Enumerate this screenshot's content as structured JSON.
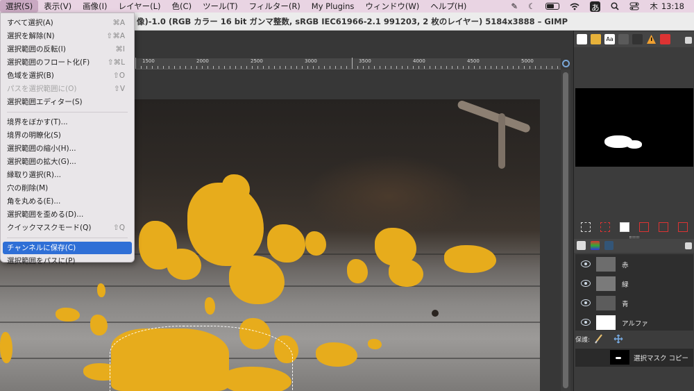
{
  "menubar": {
    "items": [
      "選択(S)",
      "表示(V)",
      "画像(I)",
      "レイヤー(L)",
      "色(C)",
      "ツール(T)",
      "フィルター(R)",
      "My Plugins",
      "ウィンドウ(W)",
      "ヘルプ(H)"
    ],
    "active_index": 0,
    "clock_day": "木",
    "clock_time": "13:18",
    "ime_label": "あ"
  },
  "window": {
    "title": "像)-1.0 (RGB カラー 16 bit ガンマ整数, sRGB IEC61966-2.1 991203, 2 枚のレイヤー) 5184x3888 – GIMP"
  },
  "ruler": {
    "labels": [
      "1500",
      "2000",
      "2500",
      "3000",
      "3500",
      "4000",
      "4500",
      "5000"
    ]
  },
  "select_menu": {
    "items": [
      {
        "label": "すべて選択(A)",
        "shortcut": "⌘A",
        "disabled": false
      },
      {
        "label": "選択を解除(N)",
        "shortcut": "⇧⌘A",
        "disabled": false
      },
      {
        "label": "選択範囲の反転(I)",
        "shortcut": "⌘I",
        "disabled": false
      },
      {
        "label": "選択範囲のフロート化(F)",
        "shortcut": "⇧⌘L",
        "disabled": false
      },
      {
        "label": "色域を選択(B)",
        "shortcut": "⇧O",
        "disabled": false
      },
      {
        "label": "パスを選択範囲に(O)",
        "shortcut": "⇧V",
        "disabled": true
      },
      {
        "label": "選択範囲エディター(S)",
        "shortcut": "",
        "disabled": false
      },
      {
        "label": "境界をぼかす(T)...",
        "shortcut": "",
        "disabled": false
      },
      {
        "label": "境界の明瞭化(S)",
        "shortcut": "",
        "disabled": false
      },
      {
        "label": "選択範囲の縮小(H)...",
        "shortcut": "",
        "disabled": false
      },
      {
        "label": "選択範囲の拡大(G)...",
        "shortcut": "",
        "disabled": false
      },
      {
        "label": "縁取り選択(R)...",
        "shortcut": "",
        "disabled": false
      },
      {
        "label": "穴の削除(M)",
        "shortcut": "",
        "disabled": false
      },
      {
        "label": "角を丸める(E)...",
        "shortcut": "",
        "disabled": false
      },
      {
        "label": "選択範囲を歪める(D)...",
        "shortcut": "",
        "disabled": false
      },
      {
        "label": "クイックマスクモード(Q)",
        "shortcut": "⇧Q",
        "disabled": false
      },
      {
        "label": "チャンネルに保存(C)",
        "shortcut": "",
        "disabled": false,
        "highlighted": true
      },
      {
        "label": "選択範囲をパスに(P)",
        "shortcut": "",
        "disabled": false
      }
    ]
  },
  "channels": {
    "rows": [
      {
        "name": "赤",
        "thumb_color": "#6d6d6d"
      },
      {
        "name": "緑",
        "thumb_color": "#7a7a7a"
      },
      {
        "name": "青",
        "thumb_color": "#5c5c5c"
      },
      {
        "name": "アルファ",
        "thumb_color": "#ffffff"
      }
    ],
    "protect_label": "保護:",
    "saved_channel": "選択マスク コピー"
  },
  "colors": {
    "menubar_bg": "#e9d4e3",
    "highlight": "#2f6fd6",
    "fungus": "#e7ac1c"
  }
}
